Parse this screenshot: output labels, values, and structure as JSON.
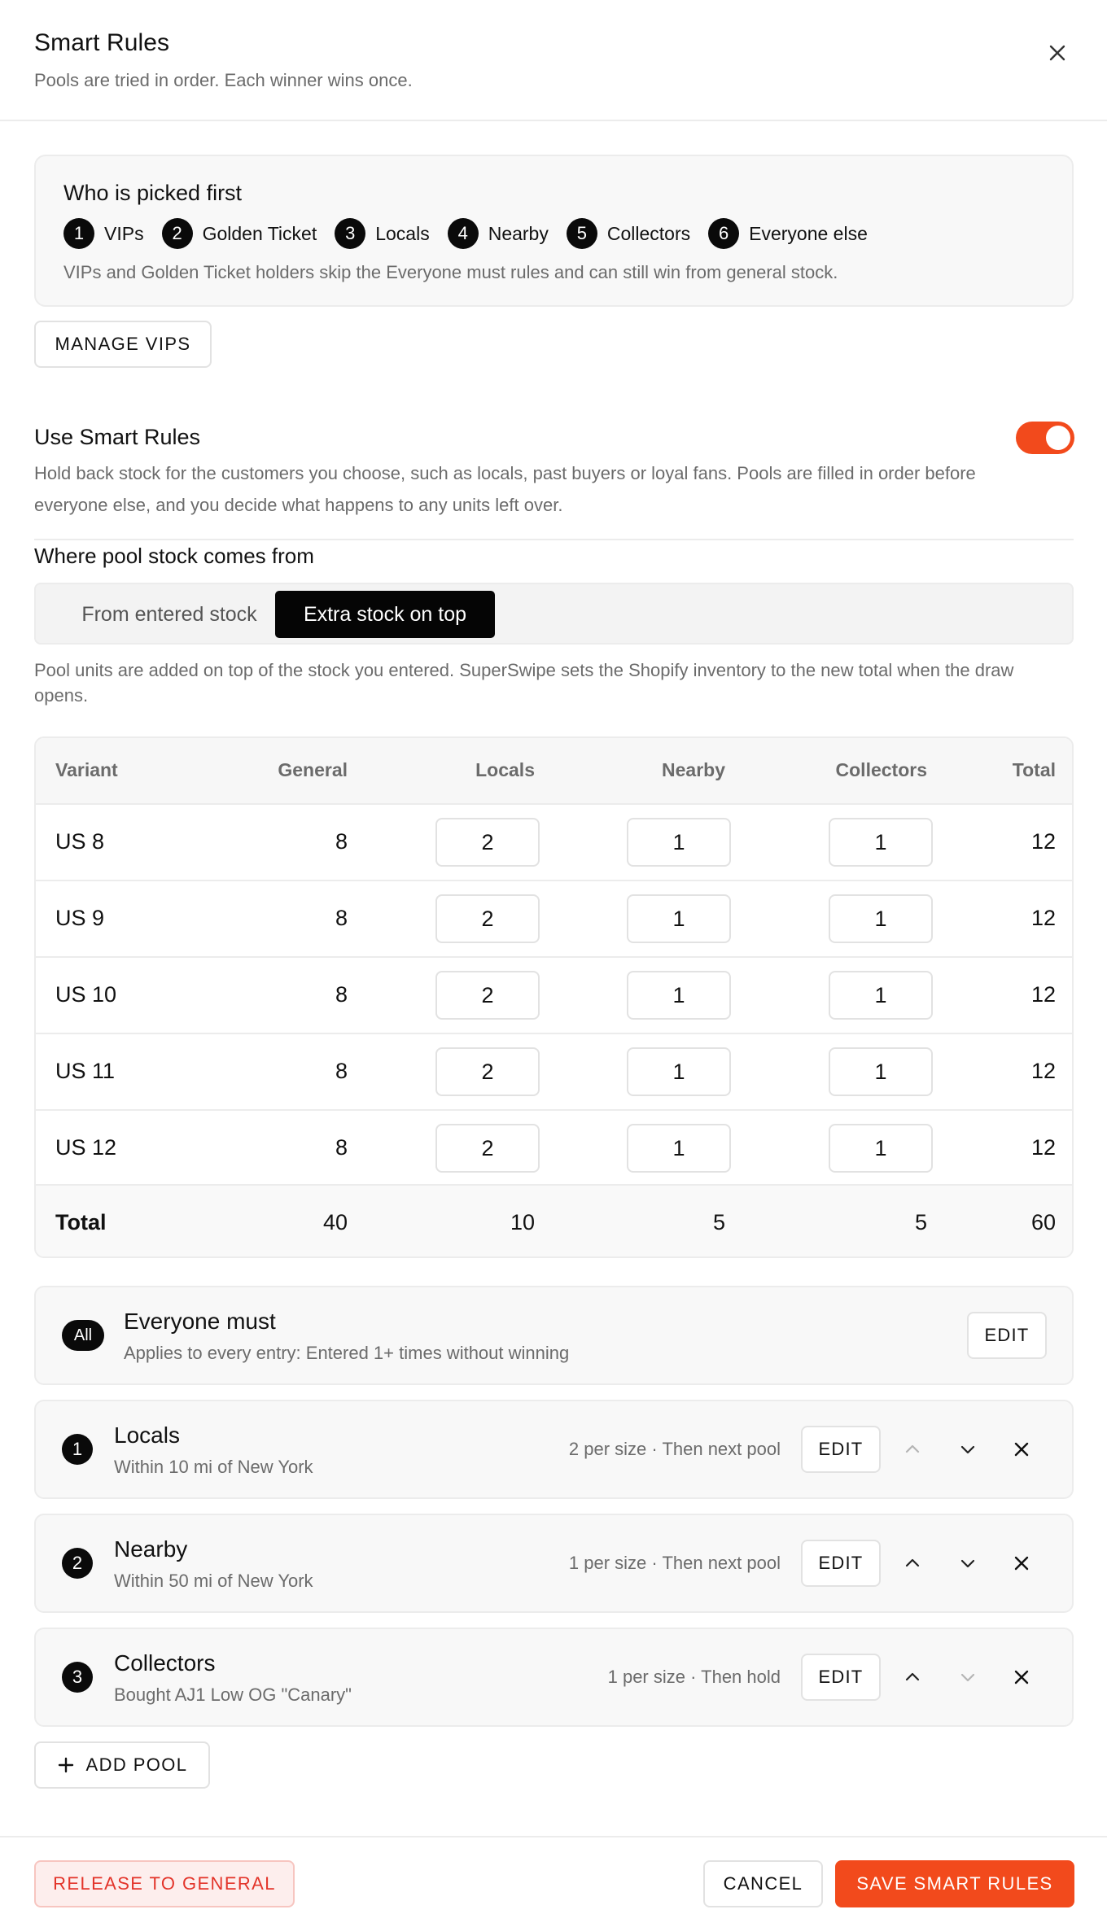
{
  "header": {
    "title": "Smart Rules",
    "subtitle": "Pools are tried in order. Each winner wins once.",
    "close_icon": "close-icon"
  },
  "picked_first": {
    "title": "Who is picked first",
    "order": [
      {
        "num": "1",
        "label": "VIPs"
      },
      {
        "num": "2",
        "label": "Golden Ticket"
      },
      {
        "num": "3",
        "label": "Locals"
      },
      {
        "num": "4",
        "label": "Nearby"
      },
      {
        "num": "5",
        "label": "Collectors"
      },
      {
        "num": "6",
        "label": "Everyone else"
      }
    ],
    "note": "VIPs and Golden Ticket holders skip the Everyone must rules and can still win from general stock."
  },
  "manage_vips_label": "MANAGE VIPS",
  "smart_rules": {
    "title": "Use Smart Rules",
    "enabled": true,
    "description": "Hold back stock for the customers you choose, such as locals, past buyers or loyal fans. Pools are filled in order before everyone else, and you decide what happens to any units left over."
  },
  "stock_source": {
    "title": "Where pool stock comes from",
    "options": [
      "From entered stock",
      "Extra stock on top"
    ],
    "selected": "Extra stock on top",
    "note": "Pool units are added on top of the stock you entered. SuperSwipe sets the Shopify inventory to the new total when the draw opens."
  },
  "table": {
    "headers": [
      "Variant",
      "General",
      "Locals",
      "Nearby",
      "Collectors",
      "Total"
    ],
    "rows": [
      {
        "variant": "US 8",
        "general": "8",
        "locals": "2",
        "nearby": "1",
        "collectors": "1",
        "total": "12"
      },
      {
        "variant": "US 9",
        "general": "8",
        "locals": "2",
        "nearby": "1",
        "collectors": "1",
        "total": "12"
      },
      {
        "variant": "US 10",
        "general": "8",
        "locals": "2",
        "nearby": "1",
        "collectors": "1",
        "total": "12"
      },
      {
        "variant": "US 11",
        "general": "8",
        "locals": "2",
        "nearby": "1",
        "collectors": "1",
        "total": "12"
      },
      {
        "variant": "US 12",
        "general": "8",
        "locals": "2",
        "nearby": "1",
        "collectors": "1",
        "total": "12"
      }
    ],
    "footer": {
      "label": "Total",
      "general": "40",
      "locals": "10",
      "nearby": "5",
      "collectors": "5",
      "total": "60"
    }
  },
  "everyone_must": {
    "badge": "All",
    "name": "Everyone must",
    "description": "Applies to every entry: Entered 1+ times without winning",
    "edit_label": "EDIT"
  },
  "pools": [
    {
      "num": "1",
      "name": "Locals",
      "description": "Within 10 mi of New York",
      "meta": "2 per size · Then next pool",
      "edit_label": "EDIT",
      "up_enabled": false,
      "down_enabled": true
    },
    {
      "num": "2",
      "name": "Nearby",
      "description": "Within 50 mi of New York",
      "meta": "1 per size · Then next pool",
      "edit_label": "EDIT",
      "up_enabled": true,
      "down_enabled": true
    },
    {
      "num": "3",
      "name": "Collectors",
      "description": "Bought AJ1 Low OG \"Canary\"",
      "meta": "1 per size · Then hold",
      "edit_label": "EDIT",
      "up_enabled": true,
      "down_enabled": false
    }
  ],
  "add_pool_label": "ADD POOL",
  "footer": {
    "release_label": "RELEASE TO GENERAL",
    "cancel_label": "CANCEL",
    "save_label": "SAVE SMART RULES"
  },
  "colors": {
    "accent": "#f24a1c",
    "danger_text": "#e3342a",
    "danger_bg": "#fdeeed",
    "muted_text": "#6b6b6b",
    "badge_bg": "#0a0a0a"
  }
}
